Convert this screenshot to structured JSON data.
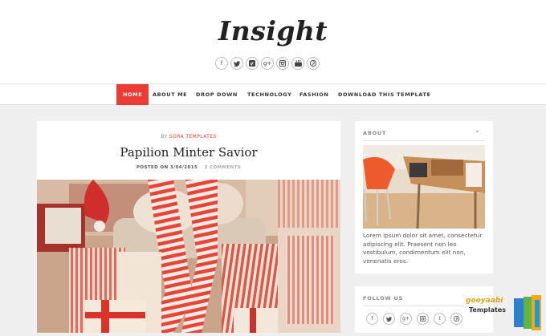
{
  "header": {
    "site_title": "Insight",
    "social_icons": [
      {
        "name": "facebook-icon",
        "glyph": "f"
      },
      {
        "name": "twitter-icon",
        "glyph": "🐦"
      },
      {
        "name": "vimeo-icon",
        "glyph": "V"
      },
      {
        "name": "google-plus-icon",
        "glyph": "g+"
      },
      {
        "name": "instagram-icon",
        "glyph": "◙"
      },
      {
        "name": "youtube-icon",
        "glyph": "▶"
      },
      {
        "name": "pinterest-icon",
        "glyph": "P"
      }
    ]
  },
  "nav": {
    "items": [
      "HOME",
      "ABOUT ME",
      "DROP DOWN",
      "TECHNOLOGY",
      "FASHION",
      "DOWNLOAD THIS TEMPLATE"
    ],
    "active_color": "#ee3a34"
  },
  "post": {
    "by": "BY",
    "author": "SORA TEMPLATES",
    "title": "Papilion Minter Savior",
    "posted_on": "POSTED ON 3/04/2015",
    "comments": "3 COMMENTS"
  },
  "sidebar": {
    "about_title": "ABOUT",
    "about_arrow": "▾",
    "about_text": "Lorem ipsum dolor sit amet, consectetur adipiscing elit. Praesent non leo vestibulum, condimentum elit non, venenatis eros.",
    "follow_title": "FOLLOW US",
    "follow_icons": [
      {
        "name": "facebook-icon",
        "glyph": "f"
      },
      {
        "name": "twitter-icon",
        "glyph": "🐦"
      },
      {
        "name": "google-plus-icon",
        "glyph": "g+"
      },
      {
        "name": "instagram-icon",
        "glyph": "◙"
      },
      {
        "name": "tumblr-icon",
        "glyph": "t"
      },
      {
        "name": "pinterest-icon",
        "glyph": "P"
      }
    ]
  },
  "watermark": {
    "line1": "gooyaabi",
    "line2": "Templates"
  }
}
